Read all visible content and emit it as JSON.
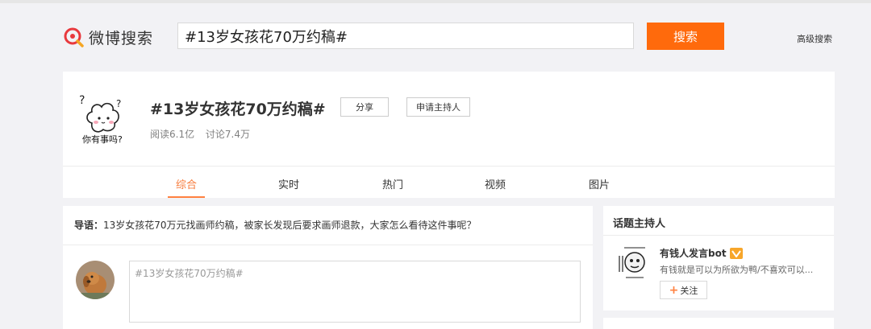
{
  "header": {
    "logo_text": "微博搜索",
    "search_value": "#13岁女孩花70万约稿#",
    "search_button": "搜索",
    "advanced_link": "高级搜索"
  },
  "topic": {
    "title": "#13岁女孩花70万约稿#",
    "share_button": "分享",
    "host_button": "申请主持人",
    "reads": "阅读6.1亿",
    "discussions": "讨论7.4万",
    "avatar_text": "你有事吗?",
    "tabs": [
      {
        "label": "综合",
        "active": true
      },
      {
        "label": "实时",
        "active": false
      },
      {
        "label": "热门",
        "active": false
      },
      {
        "label": "视频",
        "active": false
      },
      {
        "label": "图片",
        "active": false
      }
    ]
  },
  "main": {
    "guide_label": "导语：",
    "guide_text": "13岁女孩花70万元找画师约稿，被家长发现后要求画师退款，大家怎么看待这件事呢？",
    "compose_value": "#13岁女孩花70万约稿#"
  },
  "side": {
    "host_section_title": "话题主持人",
    "host_name": "有钱人发言bot",
    "host_desc": "有钱就是可以为所欲为鸭/不喜欢可以...",
    "follow_button": "关注"
  },
  "colors": {
    "accent": "#ff6a0c",
    "tab_active": "#f77c3d",
    "badge": "#f7a62a"
  }
}
